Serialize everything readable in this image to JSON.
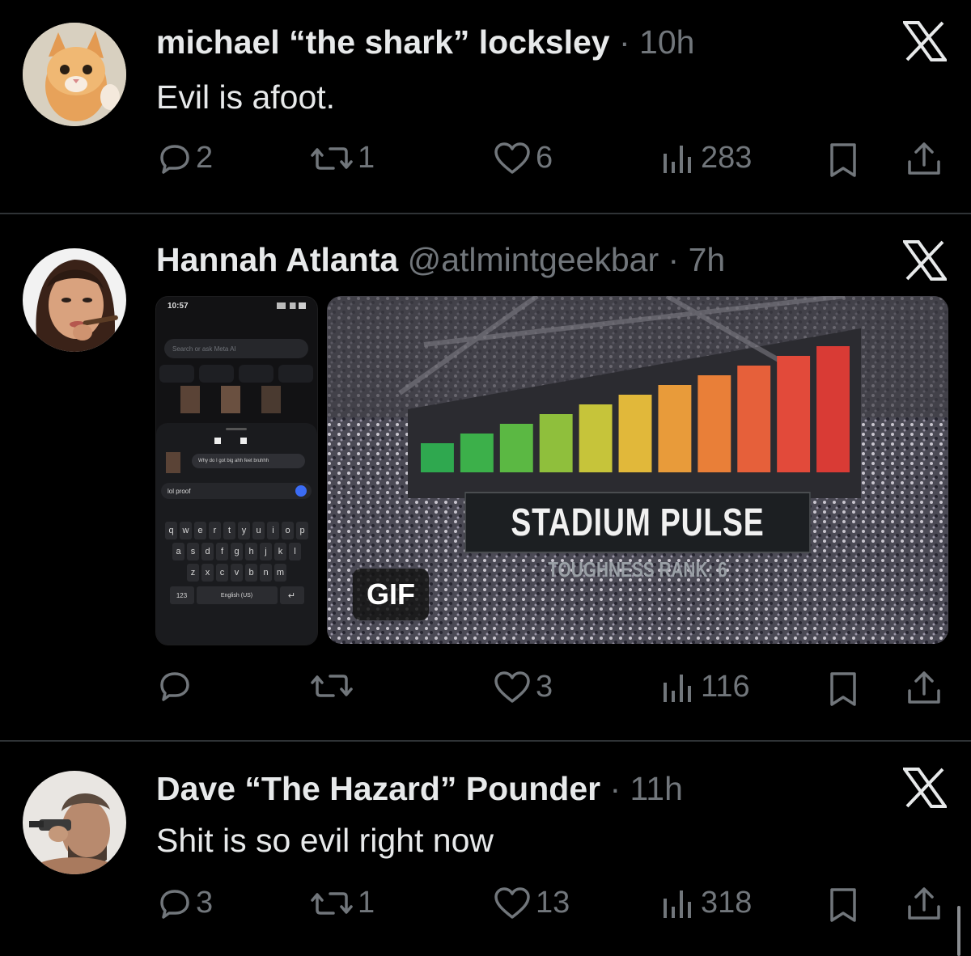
{
  "colors": {
    "background": "#000000",
    "text": "#e7e9ea",
    "muted": "#71767b",
    "divider": "#2f3336"
  },
  "posts": [
    {
      "name": "michael “the shark” locksley",
      "handle": "",
      "time": "· 10h",
      "text": "Evil is afoot.",
      "replies": "2",
      "reposts": "1",
      "likes": "6",
      "views": "283",
      "avatar_icon": "cat-avatar"
    },
    {
      "name": "Hannah Atlanta",
      "handle": "@atlmintgeekbar",
      "time": "· 7h",
      "text": "",
      "replies": "",
      "reposts": "",
      "likes": "3",
      "views": "116",
      "avatar_icon": "woman-avatar",
      "media": {
        "phone": {
          "clock": "10:57",
          "search_placeholder": "Search or ask Meta AI",
          "chat_bubble": "Why do I got big ahh feet bruhhh",
          "input_text": "lol proof",
          "keyboard_rows": [
            [
              "q",
              "w",
              "e",
              "r",
              "t",
              "y",
              "u",
              "i",
              "o",
              "p"
            ],
            [
              "a",
              "s",
              "d",
              "f",
              "g",
              "h",
              "j",
              "k",
              "l"
            ],
            [
              "z",
              "x",
              "c",
              "v",
              "b",
              "n",
              "m"
            ]
          ],
          "num_key": "123",
          "lang_key": "English (US)"
        },
        "gif": {
          "badge": "GIF",
          "title": "STADIUM PULSE",
          "subtitle": "TOUGHNESS RANK: 6",
          "meter_colors": [
            "#2fa84f",
            "#3cb04a",
            "#5bb843",
            "#8fbf3c",
            "#c6c43a",
            "#e1b83a",
            "#e89b3a",
            "#e97f38",
            "#e6603a",
            "#e24a3a",
            "#d93b35"
          ]
        }
      }
    },
    {
      "name": "Dave “The Hazard” Pounder",
      "handle": "",
      "time": "· 11h",
      "text": "Shit is so evil right now",
      "replies": "3",
      "reposts": "1",
      "likes": "13",
      "views": "318",
      "avatar_icon": "man-avatar"
    }
  ]
}
